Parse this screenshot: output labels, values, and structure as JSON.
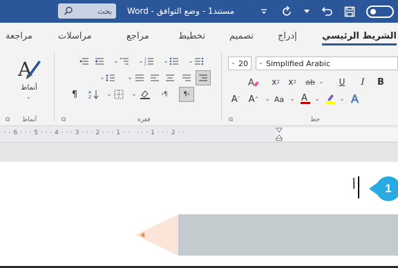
{
  "titlebar": {
    "search_label": "بحث",
    "document_title": "مستند1 - وضع التوافق - Word",
    "icons": [
      "autosave-toggle",
      "save-icon",
      "redo-icon",
      "undo-icon",
      "customize-qat-icon",
      "search-icon"
    ]
  },
  "tabs": [
    {
      "label": "الشريط الرئيسي",
      "active": true
    },
    {
      "label": "إدراج",
      "active": false
    },
    {
      "label": "تصميم",
      "active": false
    },
    {
      "label": "تخطيط",
      "active": false
    },
    {
      "label": "مراجع",
      "active": false
    },
    {
      "label": "مراسلات",
      "active": false
    },
    {
      "label": "مراجعة",
      "active": false
    }
  ],
  "ribbon": {
    "font": {
      "font_name": "Simplified Arabic",
      "font_size": "20",
      "group_label": "خط",
      "buttons": {
        "bold": "B",
        "italic": "I",
        "underline": "U",
        "strike": "ab",
        "subscript": "x",
        "superscript": "x",
        "grow": "A",
        "shrink": "A",
        "change_case": "Aa"
      }
    },
    "paragraph": {
      "group_label": "فقرة"
    },
    "styles": {
      "button_label": "أنماط",
      "group_label": "أنماط"
    }
  },
  "ruler": {
    "text": "· · 6 · · · 5 · · · 4 · · · 3 · · · 2 · · · 1 · ·   · · · 1 · · · 2 · ·"
  },
  "document": {
    "typed_text": "أ",
    "step_number": "1"
  },
  "colors": {
    "titlebar": "#2b579a",
    "ribbon": "#f3f3f3",
    "accent": "#2b579a",
    "step_badge": "#29abe2",
    "band": "#c3cbcf",
    "highlight_pointer": "#fbe4d8",
    "font_color": "#c00000",
    "highlight_color": "#ffff00"
  }
}
